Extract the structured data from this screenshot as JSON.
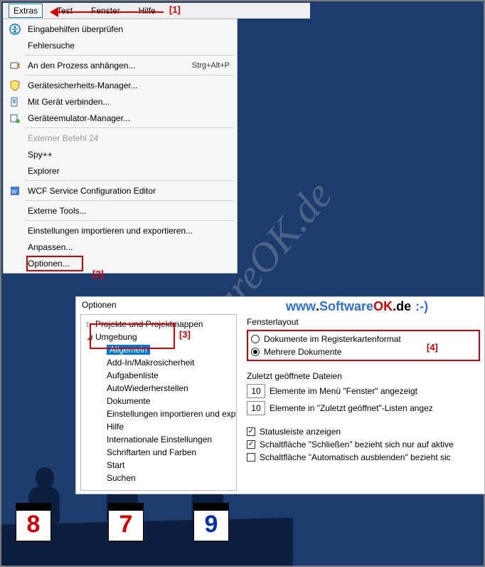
{
  "menubar": {
    "extras": "Extras",
    "test": "Test",
    "fenster": "Fenster",
    "hilfe": "Hilfe"
  },
  "callouts": {
    "c1": "[1]",
    "c2": "[2]",
    "c3": "[3]",
    "c4": "[4]"
  },
  "dropdown": {
    "items": [
      {
        "label": "Eingabehilfen überprüfen",
        "icon": "accessibility"
      },
      {
        "label": "Fehlersuche",
        "icon": ""
      },
      {
        "label": "An den Prozess anhängen...",
        "icon": "attach",
        "shortcut": "Strg+Alt+P"
      },
      {
        "label": "Gerätesicherheits-Manager...",
        "icon": "shield"
      },
      {
        "label": "Mit Gerät verbinden...",
        "icon": "device"
      },
      {
        "label": "Geräteemulator-Manager...",
        "icon": "emulator"
      },
      {
        "label": "Externer Befehl 24",
        "icon": "",
        "disabled": true
      },
      {
        "label": "Spy++",
        "icon": ""
      },
      {
        "label": "Explorer",
        "icon": ""
      },
      {
        "label": "WCF Service Configuration Editor",
        "icon": "wcf"
      },
      {
        "label": "Externe Tools...",
        "icon": ""
      },
      {
        "label": "Einstellungen importieren und exportieren...",
        "icon": ""
      },
      {
        "label": "Anpassen...",
        "icon": ""
      },
      {
        "label": "Optionen...",
        "icon": ""
      }
    ]
  },
  "options": {
    "title": "Optionen",
    "tree": {
      "projekte": "Projekte und Projektmappen",
      "umgebung": "Umgebung",
      "children": [
        "Allgemein",
        "Add-In/Makrosicherheit",
        "Aufgabenliste",
        "AutoWiederherstellen",
        "Dokumente",
        "Einstellungen importieren und exp",
        "Hilfe",
        "Internationale Einstellungen",
        "Schriftarten und Farben",
        "Start",
        "Suchen"
      ]
    },
    "pane": {
      "layout_title": "Fensterlayout",
      "radio_tabbed": "Dokumente im Registerkartenformat",
      "radio_multi": "Mehrere Dokumente",
      "recent_title": "Zuletzt geöffnete Dateien",
      "recent_val1": "10",
      "recent_lbl1": "Elemente im Menü \"Fenster\" angezeigt",
      "recent_val2": "10",
      "recent_lbl2": "Elemente in \"Zuletzt geöffnet\"-Listen angez",
      "chk_status": "Statusleiste anzeigen",
      "chk_close": "Schaltfläche \"Schließen\" bezieht sich nur auf aktive",
      "chk_autohide": "Schaltfläche \"Automatisch ausblenden\" bezieht sic"
    }
  },
  "site": {
    "www": "www",
    "software": "Software",
    "ok": "OK",
    "de": "de",
    "smile": ":-)"
  },
  "scores": {
    "s8": "8",
    "s7": "7",
    "s9": "9"
  },
  "watermark": "SoftwareOK.de"
}
